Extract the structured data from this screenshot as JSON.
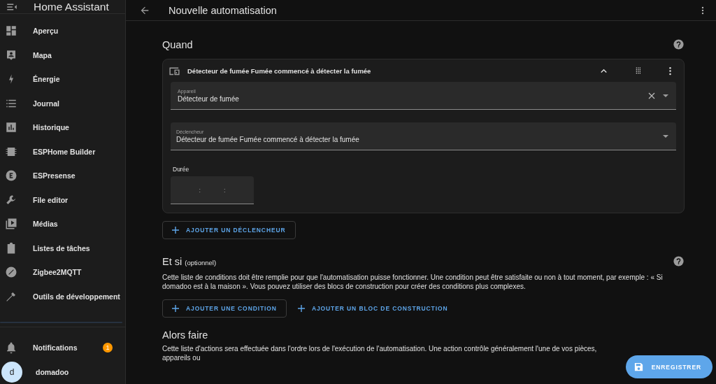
{
  "sidebar": {
    "title": "Home Assistant",
    "items": [
      {
        "label": "Aperçu"
      },
      {
        "label": "Mapa"
      },
      {
        "label": "Énergie"
      },
      {
        "label": "Journal"
      },
      {
        "label": "Historique"
      },
      {
        "label": "ESPHome Builder"
      },
      {
        "label": "ESPresense"
      },
      {
        "label": "File editor"
      },
      {
        "label": "Médias"
      },
      {
        "label": "Listes de tâches"
      },
      {
        "label": "Zigbee2MQTT"
      },
      {
        "label": "Outils de développement"
      }
    ],
    "notifications": {
      "label": "Notifications",
      "badge": "1"
    },
    "user": {
      "initial": "d",
      "name": "domadoo"
    }
  },
  "toolbar": {
    "title": "Nouvelle automatisation"
  },
  "when": {
    "title": "Quand",
    "trigger": {
      "title": "Détecteur de fumée Fumée commencé à détecter la fumée",
      "device_field": {
        "label": "Appareil",
        "value": "Détecteur de fumée"
      },
      "trigger_field": {
        "label": "Déclencheur",
        "value": "Détecteur de fumée Fumée commencé à détecter la fumée"
      },
      "duration": {
        "label": "Durée",
        "separators": [
          ":",
          ":"
        ]
      }
    },
    "buttons": [
      {
        "label": "AJOUTER UN DÉCLENCHEUR",
        "kind": "outlined"
      }
    ]
  },
  "conditions": {
    "title": "Et si",
    "note": "(optionnel)",
    "description": "Cette liste de conditions doit être remplie pour que l'automatisation puisse fonctionner. Une condition peut être satisfaite ou non à tout moment, par exemple : « Si domadoo est à la maison ». Vous pouvez utiliser des blocs de construction pour créer des conditions plus complexes.",
    "buttons": [
      {
        "label": "AJOUTER UNE CONDITION",
        "kind": "outlined"
      },
      {
        "label": "AJOUTER UN BLOC DE CONSTRUCTION",
        "kind": "text"
      }
    ]
  },
  "actions": {
    "title": "Alors faire",
    "description": "Cette liste d'actions sera effectuée dans l'ordre lors de l'exécution de l'automatisation. Une action contrôle généralement l'une de vos pièces, appareils ou"
  },
  "save_button": "ENREGISTRER"
}
